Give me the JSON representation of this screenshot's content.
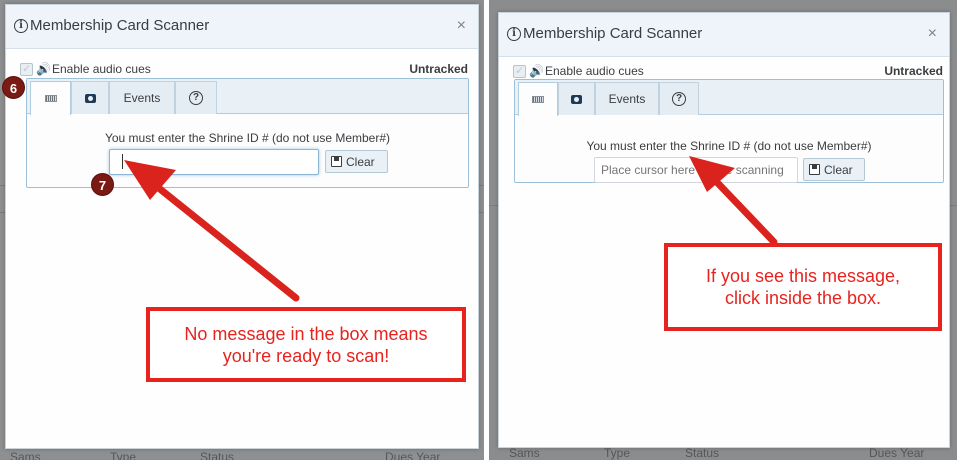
{
  "panels": [
    {
      "dialog": {
        "title": "Membership Card Scanner",
        "close_glyph": "×",
        "audio_label": "Enable audio cues",
        "status": "Untracked",
        "tabs": {
          "events": "Events"
        },
        "instruction": "You must enter the Shrine ID # (do not use Member#)",
        "input": {
          "value": "",
          "placeholder": ""
        },
        "clear_label": "Clear"
      },
      "badges": [
        "6",
        "7"
      ],
      "callout": {
        "line1": "No message in the box means",
        "line2": "you're ready to scan!"
      }
    },
    {
      "dialog": {
        "title": "Membership Card Scanner",
        "close_glyph": "×",
        "audio_label": "Enable audio cues",
        "status": "Untracked",
        "tabs": {
          "events": "Events"
        },
        "instruction": "You must enter the Shrine ID # (do not use Member#)",
        "input": {
          "value": "",
          "placeholder": "Place cursor here before scanning"
        },
        "clear_label": "Clear"
      },
      "callout": {
        "line1": "If you see this message,",
        "line2": "click inside the box."
      }
    }
  ],
  "colors": {
    "callout_red": "#e8231e",
    "badge": "#7a1a14",
    "accent_border": "#9cc0da"
  },
  "icons": [
    "info-icon",
    "close-icon",
    "checkbox-icon",
    "speaker-icon",
    "barcode-icon",
    "camera-icon",
    "help-icon",
    "save-icon"
  ],
  "background": {
    "fragments": [
      "Sams",
      "Type",
      "Status",
      "Dues Year"
    ]
  }
}
